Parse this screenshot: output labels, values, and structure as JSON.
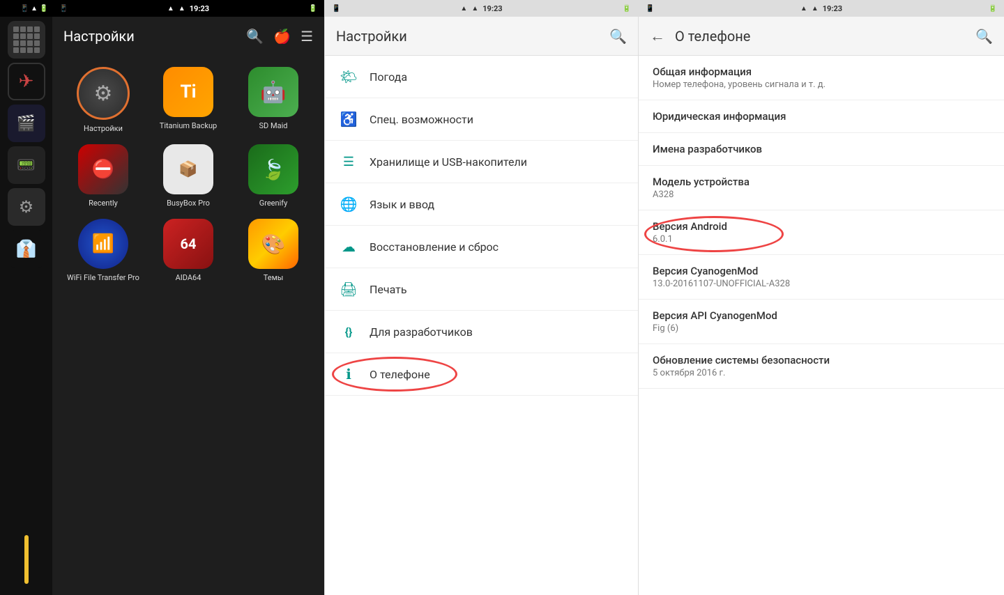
{
  "panels": {
    "left_sidebar": {
      "icons": [
        "⊞",
        "✈",
        "🎬",
        "⏰",
        "⚙",
        "👔"
      ]
    },
    "settings_panel": {
      "status_bar": {
        "left": "📱",
        "time": "19:23",
        "right": "🔋"
      },
      "title": "Настройки",
      "search_icon": "🔍",
      "apple_icon": "🍎",
      "menu_icon": "☰",
      "apps": [
        {
          "label": "Настройки",
          "icon_type": "settings",
          "selected": true
        },
        {
          "label": "Titanium Backup",
          "icon_type": "titanium",
          "selected": false
        },
        {
          "label": "SD Maid",
          "icon_type": "sdmaid",
          "selected": false
        },
        {
          "label": "Recently",
          "icon_type": "recently",
          "selected": false
        },
        {
          "label": "BusyBox Pro",
          "icon_type": "busybox",
          "selected": false
        },
        {
          "label": "Greenify",
          "icon_type": "greenify",
          "selected": false
        },
        {
          "label": "WiFi File Transfer Pro",
          "icon_type": "wifi",
          "selected": false
        },
        {
          "label": "AIDA64",
          "icon_type": "aida",
          "selected": false
        },
        {
          "label": "Темы",
          "icon_type": "temy",
          "selected": false
        }
      ]
    },
    "settings_list": {
      "title": "Настройки",
      "items": [
        {
          "icon": "☁",
          "label": "Погода",
          "active": false
        },
        {
          "icon": "♿",
          "label": "Спец. возможности",
          "active": false
        },
        {
          "icon": "💾",
          "label": "Хранилище и USB-накопители",
          "active": false
        },
        {
          "icon": "🌐",
          "label": "Язык и ввод",
          "active": false
        },
        {
          "icon": "☁",
          "label": "Восстановление и сброс",
          "active": false
        },
        {
          "icon": "🖨",
          "label": "Печать",
          "active": false
        },
        {
          "icon": "{}",
          "label": "Для разработчиков",
          "active": false
        },
        {
          "icon": "ℹ",
          "label": "О телефоне",
          "active": true,
          "has_circle": true
        }
      ]
    },
    "about_phone": {
      "title": "О телефоне",
      "back_icon": "←",
      "search_icon": "🔍",
      "items": [
        {
          "title": "Общая информация",
          "subtitle": "Номер телефона, уровень сигнала и т. д.",
          "has_circle": false
        },
        {
          "title": "Юридическая информация",
          "subtitle": "",
          "has_circle": false
        },
        {
          "title": "Имена разработчиков",
          "subtitle": "",
          "has_circle": false
        },
        {
          "title": "Модель устройства",
          "subtitle": "A328",
          "has_circle": false
        },
        {
          "title": "Версия Android",
          "subtitle": "6.0.1",
          "has_circle": true
        },
        {
          "title": "Версия CyanogenMod",
          "subtitle": "13.0-20161107-UNOFFICIAL-A328",
          "has_circle": false
        },
        {
          "title": "Версия API CyanogenMod",
          "subtitle": "Fig (6)",
          "has_circle": false
        },
        {
          "title": "Обновление системы безопасности",
          "subtitle": "5 октября 2016 г.",
          "has_circle": false
        }
      ]
    }
  }
}
